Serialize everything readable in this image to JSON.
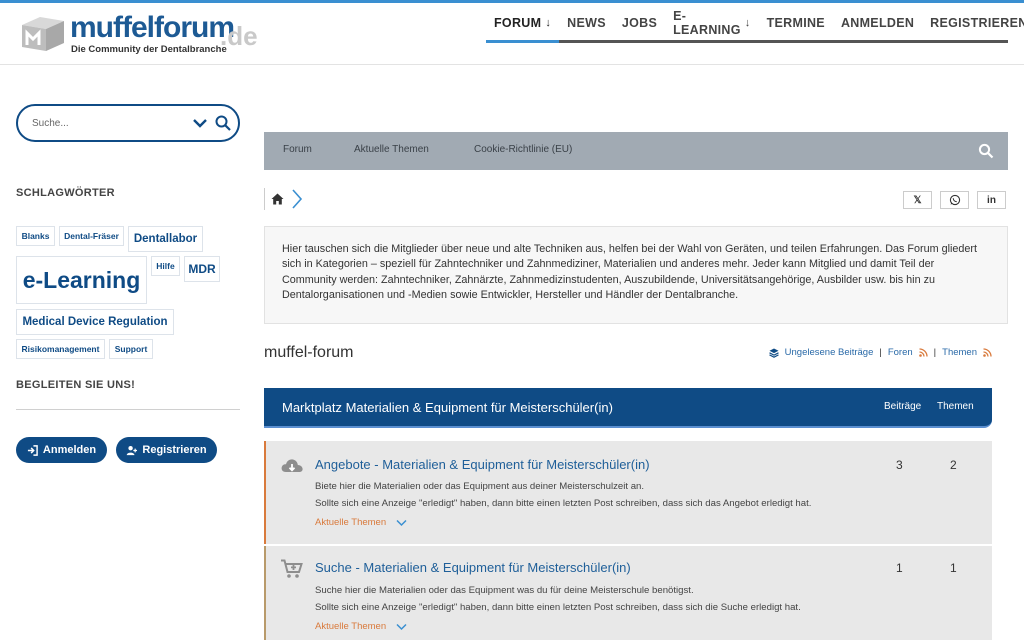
{
  "header": {
    "logo_word": "muffelforum",
    "logo_tld": ".de",
    "logo_tagline": "Die Community der Dentalbranche",
    "nav": [
      {
        "label": "FORUM",
        "arrow": "↓"
      },
      {
        "label": "NEWS"
      },
      {
        "label": "JOBS"
      },
      {
        "label": "E-LEARNING",
        "arrow": "↓"
      },
      {
        "label": "TERMINE"
      },
      {
        "label": "ANMELDEN"
      },
      {
        "label": "REGISTRIEREN"
      }
    ]
  },
  "sidebar": {
    "search_placeholder": "Suche...",
    "tags_heading": "SCHLAGWÖRTER",
    "tags": [
      "Blanks",
      "Dental-Fräser",
      "Dentallabor",
      "e-Learning",
      "Hilfe",
      "MDR",
      "Medical Device Regulation",
      "Risikomanagement",
      "Support"
    ],
    "follow_heading": "BEGLEITEN SIE UNS!",
    "login_label": "Anmelden",
    "register_label": "Registrieren"
  },
  "subnav": {
    "items": [
      "Forum",
      "Aktuelle Themen",
      "Cookie-Richtlinie (EU)"
    ]
  },
  "share": {
    "x_label": "𝕏",
    "linkedin_label": "in"
  },
  "intro_text": "Hier tauschen sich die Mitglieder über neue und alte Techniken aus, helfen bei der Wahl von Geräten, und teilen Erfahrungen. Das Forum gliedert sich in Kategorien – speziell für Zahntechniker und Zahnmediziner, Materialien und anderes mehr. Jeder kann Mitglied und damit Teil der Community werden: Zahntechniker, Zahnärzte, Zahnmedizinstudenten, Auszubildende, Universitätsangehörige, Ausbilder usw. bis hin zu Dentalorganisationen und -Medien sowie Entwickler, Hersteller und Händler der Dentalbranche.",
  "forum": {
    "title": "muffel-forum",
    "links": {
      "unread": "Ungelesene Beiträge",
      "forums": "Foren",
      "topics": "Themen",
      "sep": "|"
    }
  },
  "category": {
    "title": "Marktplatz Materialien & Equipment für Meisterschüler(in)",
    "col_posts": "Beiträge",
    "col_topics": "Themen"
  },
  "rows": [
    {
      "title": "Angebote - Materialien & Equipment für Meisterschüler(in)",
      "desc1": "Biete hier die Materialien oder das Equipment aus deiner Meisterschulzeit an.",
      "desc2": "Sollte sich eine Anzeige \"erledigt\" haben, dann bitte einen letzten Post schreiben, dass sich das Angebot erledigt hat.",
      "sub": "Aktuelle Themen",
      "posts": "3",
      "topics": "2",
      "icon": "cloud-download-icon"
    },
    {
      "title": "Suche - Materialien & Equipment für Meisterschüler(in)",
      "desc1": "Suche hier die Materialien oder das Equipment was du für deine Meisterschule benötigst.",
      "desc2": "Sollte sich eine Anzeige \"erledigt\" haben, dann bitte einen letzten Post schreiben, dass sich die Suche erledigt hat.",
      "sub": "Aktuelle Themen",
      "posts": "1",
      "topics": "1",
      "icon": "cart-plus-icon"
    }
  ],
  "colors": {
    "brand_blue": "#0f4b85",
    "accent_light_blue": "#3a8fd1",
    "row_accent_orange": "#d97a3c",
    "subnav_gray": "#a1aab3"
  }
}
